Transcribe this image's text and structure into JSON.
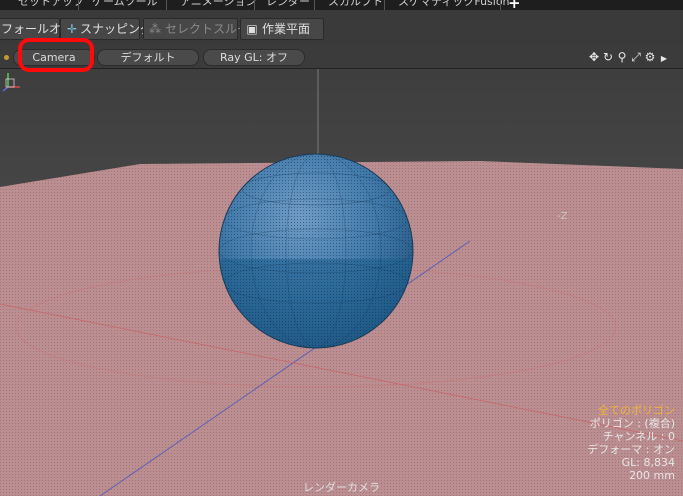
{
  "menu_tabs": [
    "セットアップ",
    "ゲームツール",
    "アニメーション",
    "レンダー",
    "スカルプト",
    "スケマティックFusion"
  ],
  "add_tab_label": "+",
  "toolbar": {
    "falloff": "フォールオフ",
    "snapping": "スナッピング",
    "select_through": "セレクトスルー",
    "work_plane": "作業平面"
  },
  "viewport_bar": {
    "camera": "Camera",
    "default": "デフォルト",
    "raygl": "Ray GL: オフ"
  },
  "icons": [
    "move-icon",
    "rotate-icon",
    "zoom-icon",
    "maximize-icon",
    "gear-icon",
    "dropdown-icon"
  ],
  "viewport": {
    "axis_label": "-Z",
    "info": {
      "all_polygons": "全てのポリゴン",
      "polygon": "ポリゴン : (複合)",
      "channel": "チャンネル : 0",
      "deformer": "デフォーマ : オン",
      "gl": "GL: 8,834",
      "size": "200 mm"
    },
    "camera_name": "レンダーカメラ"
  },
  "colors": {
    "highlight": "#ff0a0a",
    "sphere": "#3f78a8",
    "ground": "#b78a8d"
  }
}
